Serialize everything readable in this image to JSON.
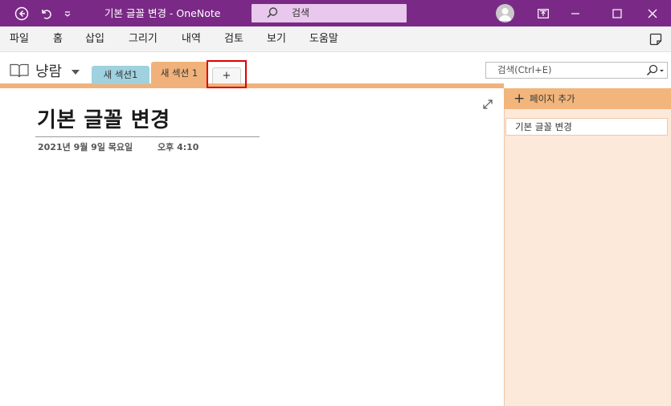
{
  "titlebar": {
    "title": "기본 글꼴 변경  -  OneNote",
    "search_label": "검색",
    "bg_color": "#7a2a86"
  },
  "icons": {
    "back": "back-circle-icon",
    "undo": "undo-icon",
    "quick_access": "quick-access-dropdown-icon",
    "account": "account-icon",
    "full_screen": "full-screen-icon",
    "minimize": "minimize-icon",
    "maximize": "maximize-icon",
    "close": "close-icon",
    "sticky_notes": "sticky-notes-icon",
    "notebook": "notebook-icon",
    "expand": "expand-icon",
    "search": "search-icon"
  },
  "menu": {
    "items": [
      "파일",
      "홈",
      "삽입",
      "그리기",
      "내역",
      "검토",
      "보기",
      "도움말"
    ]
  },
  "notebook": {
    "name": "냥람"
  },
  "sections": {
    "tabs": [
      {
        "label": "새 섹션1",
        "color": "#9fd1df"
      },
      {
        "label": "새 섹션 1",
        "color": "#f0b27a",
        "active": true
      }
    ],
    "add_tab_label": "+"
  },
  "search": {
    "placeholder": "검색(Ctrl+E)"
  },
  "page": {
    "title": "기본 글꼴 변경",
    "date": "2021년 9월 9일 목요일",
    "time": "오후 4:10"
  },
  "page_list": {
    "add_page_label": "페이지 추가",
    "items": [
      "기본 글꼴 변경"
    ]
  }
}
